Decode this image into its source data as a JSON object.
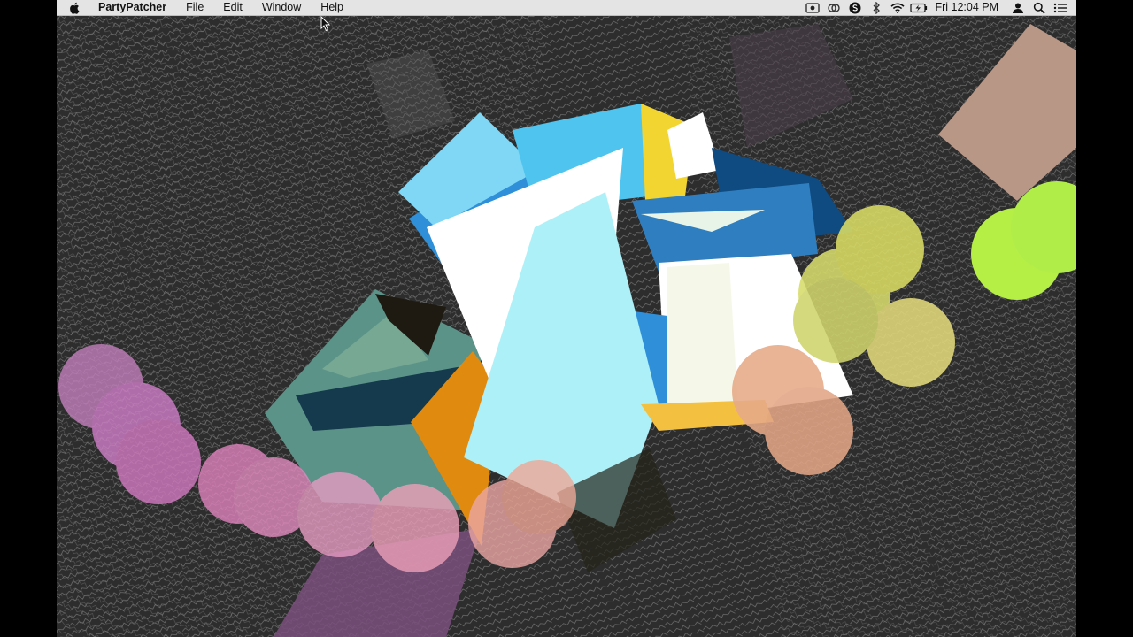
{
  "menubar": {
    "apple_icon": "apple-logo-icon",
    "app_name": "PartyPatcher",
    "menus": [
      {
        "label": "File"
      },
      {
        "label": "Edit"
      },
      {
        "label": "Window"
      },
      {
        "label": "Help"
      }
    ],
    "status_icons": [
      "screen-record-icon",
      "creative-cloud-icon",
      "circle-s-icon",
      "bluetooth-icon",
      "wifi-icon",
      "battery-charging-icon"
    ],
    "clock": "Fri 12:04 PM",
    "right_icons": [
      "user-icon",
      "spotlight-search-icon",
      "notification-center-icon"
    ]
  },
  "visualizer": {
    "content": "generative-3d-visualization",
    "colors": {
      "background": "#2d2d2d",
      "cube_light_blue": "#7fd6f5",
      "cube_blue": "#2f8fd8",
      "cube_white": "#ffffff",
      "cube_teal": "#5c9389",
      "cube_orange": "#e08a10",
      "cube_yellow": "#f3d531",
      "circle_pink": "#e37fbf",
      "circle_peach": "#e6aa88",
      "circle_yellow_green": "#d7dc6c",
      "circle_lime": "#b5ef45",
      "rect_tan": "#b89786",
      "rect_purple": "#7a4f7d"
    }
  }
}
